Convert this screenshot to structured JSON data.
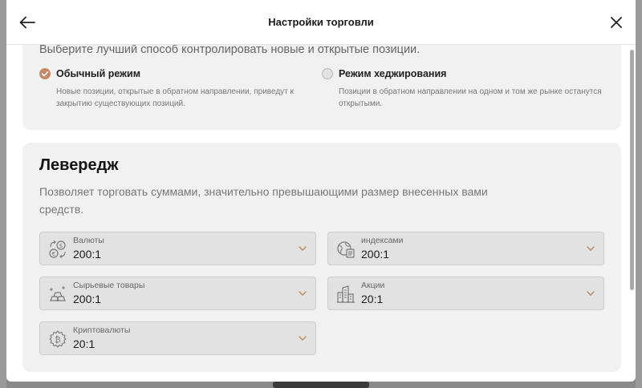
{
  "header": {
    "title": "Настройки торговли"
  },
  "position_mode": {
    "description": "Выберите лучший способ контролировать новые и открытые позиции.",
    "options": [
      {
        "label": "Обычный режим",
        "description": "Новые позиции, открытые в обратном направлении, приведут к закрытию существующих позиций.",
        "selected": true
      },
      {
        "label": "Режим хеджирования",
        "description": "Позиции в обратном направлении на одном и том же рынке останутся открытыми.",
        "selected": false
      }
    ]
  },
  "leverage": {
    "title": "Левередж",
    "description": "Позволяет торговать суммами, значительно превышающими размер внесенных вами средств.",
    "fields": [
      {
        "label": "Валюты",
        "value": "200:1",
        "icon": "currency-exchange-icon"
      },
      {
        "label": "индексами",
        "value": "200:1",
        "icon": "globe-document-icon"
      },
      {
        "label": "Сырьевые товары",
        "value": "200:1",
        "icon": "gold-bars-icon"
      },
      {
        "label": "Акции",
        "value": "20:1",
        "icon": "buildings-icon"
      },
      {
        "label": "Криптовалюты",
        "value": "20:1",
        "icon": "bitcoin-icon"
      }
    ]
  },
  "colors": {
    "accent": "#c58a64",
    "card_background": "#f1f1f1",
    "field_background": "#e2e2e2"
  }
}
